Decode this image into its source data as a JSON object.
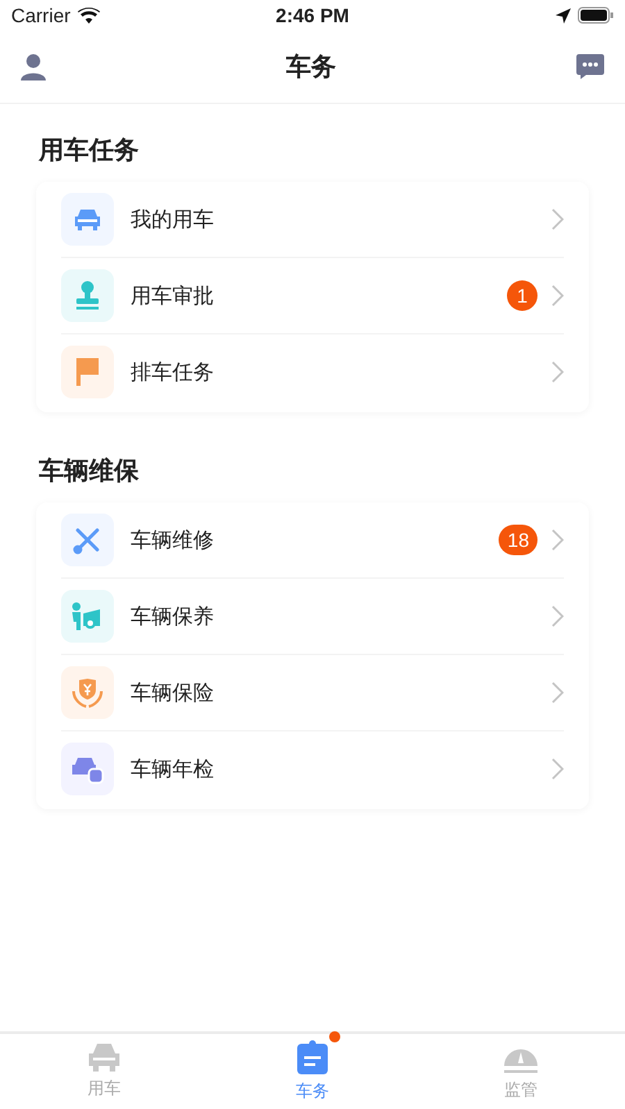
{
  "status_bar": {
    "carrier": "Carrier",
    "time": "2:46 PM"
  },
  "nav_bar": {
    "title": "车务"
  },
  "sections": [
    {
      "title": "用车任务",
      "items": [
        {
          "kind": "car",
          "label": "我的用车"
        },
        {
          "kind": "stamp",
          "label": "用车审批",
          "badge": "1"
        },
        {
          "kind": "flag",
          "label": "排车任务"
        }
      ]
    },
    {
      "title": "车辆维保",
      "items": [
        {
          "kind": "tools",
          "label": "车辆维修",
          "badge": "18"
        },
        {
          "kind": "service",
          "label": "车辆保养"
        },
        {
          "kind": "insurance",
          "label": "车辆保险"
        },
        {
          "kind": "inspection",
          "label": "车辆年检"
        }
      ]
    }
  ],
  "tab_bar": [
    {
      "kind": "car",
      "label": "用车",
      "selected": false,
      "dot": false
    },
    {
      "kind": "clipboard",
      "label": "车务",
      "selected": true,
      "dot": true
    },
    {
      "kind": "gauge",
      "label": "监管",
      "selected": false,
      "dot": false
    }
  ]
}
